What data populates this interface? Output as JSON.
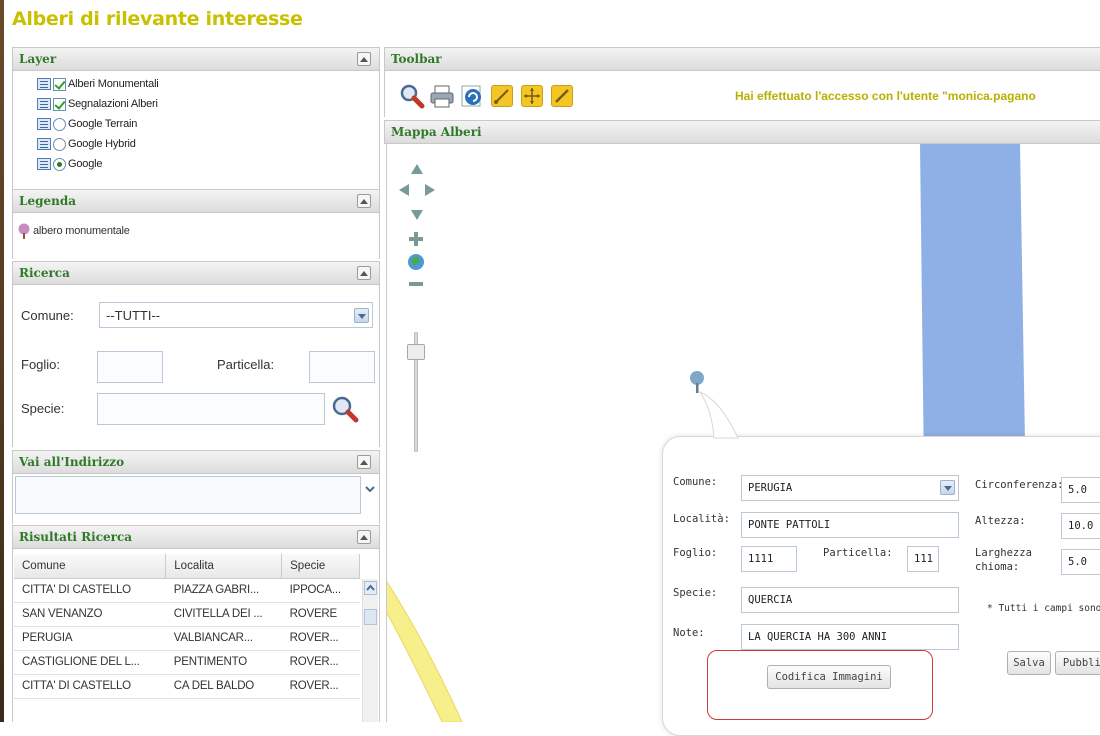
{
  "app": {
    "title": "Alberi di rilevante interesse"
  },
  "layers": {
    "header": "Layer",
    "items": [
      {
        "label": "Alberi Monumentali",
        "control": "checkbox",
        "checked": true
      },
      {
        "label": "Segnalazioni Alberi",
        "control": "checkbox",
        "checked": true
      },
      {
        "label": "Google Terrain",
        "control": "radio",
        "checked": false
      },
      {
        "label": "Google Hybrid",
        "control": "radio",
        "checked": false
      },
      {
        "label": "Google",
        "control": "radio",
        "checked": true
      }
    ]
  },
  "legend": {
    "header": "Legenda",
    "item": "albero monumentale"
  },
  "search": {
    "header": "Ricerca",
    "comune_label": "Comune:",
    "comune_value": "--TUTTI--",
    "foglio_label": "Foglio:",
    "particella_label": "Particella:",
    "specie_label": "Specie:"
  },
  "address": {
    "header": "Vai all'Indirizzo"
  },
  "results": {
    "header": "Risultati Ricerca",
    "columns": [
      "Comune",
      "Localita",
      "Specie"
    ],
    "rows": [
      [
        "CITTA' DI CASTELLO",
        "PIAZZA GABRI...",
        "IPPOCA..."
      ],
      [
        "SAN VENANZO",
        "CIVITELLA DEI ...",
        "ROVERE"
      ],
      [
        "PERUGIA",
        "VALBIANCAR...",
        "ROVER..."
      ],
      [
        "CASTIGLIONE DEL L...",
        "PENTIMENTO",
        "ROVER..."
      ],
      [
        "CITTA' DI CASTELLO",
        "CA DEL BALDO",
        "ROVER..."
      ]
    ]
  },
  "toolbar": {
    "header": "Toolbar",
    "login_message": "Hai effettuato l'accesso con l'utente \"monica.pagano"
  },
  "map": {
    "header": "Mappa Alberi"
  },
  "popup": {
    "comune_label": "Comune:",
    "comune_value": "PERUGIA",
    "localita_label": "Località:",
    "localita_value": "PONTE PATTOLI",
    "foglio_label": "Foglio:",
    "foglio_value": "1111",
    "particella_label": "Particella:",
    "particella_value": "111",
    "specie_label": "Specie:",
    "specie_value": "QUERCIA",
    "note_label": "Note:",
    "note_value": "LA QUERCIA HA 300 ANNI",
    "circonferenza_label": "Circonferenza:",
    "circonferenza_value": "5.0",
    "altezza_label": "Altezza:",
    "altezza_value": "10.0",
    "larghezza_label_1": "Larghezza",
    "larghezza_label_2": "chioma:",
    "larghezza_value": "5.0",
    "required_note": "* Tutti i campi sono o",
    "codifica_button": "Codifica Immagini",
    "salva_button": "Salva",
    "pubblica_button": "Pubblic"
  },
  "colors": {
    "title": "#c9c100",
    "header_text": "#2f7a27",
    "login": "#b8b000",
    "river": "#8fb0e6",
    "road": "#f7ef8a",
    "highlight": "#d23a3a"
  }
}
